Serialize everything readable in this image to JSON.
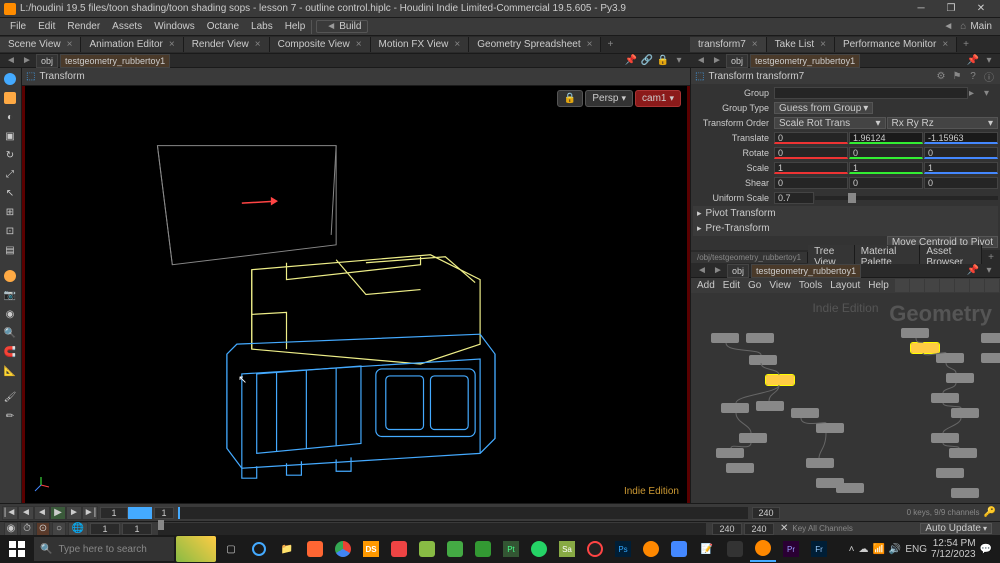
{
  "titlebar": {
    "path": "L:/houdini 19.5 files/toon shading/toon shading sops - lesson 7 - outline control.hiplc - Houdini Indie Limited-Commercial 19.5.605 - Py3.9"
  },
  "menubar": {
    "items": [
      "File",
      "Edit",
      "Render",
      "Assets",
      "Windows",
      "Octane",
      "Labs",
      "Help"
    ],
    "build": "Build",
    "main": "Main"
  },
  "left_tabs": {
    "items": [
      "Scene View",
      "Animation Editor",
      "Render View",
      "Composite View",
      "Motion FX View",
      "Geometry Spreadsheet"
    ]
  },
  "right_top_tabs": {
    "items": [
      "transform7",
      "Take List",
      "Performance Monitor"
    ]
  },
  "path_left": {
    "obj": "obj",
    "geo": "testgeometry_rubbertoy1"
  },
  "path_right": {
    "obj": "obj",
    "geo": "testgeometry_rubbertoy1"
  },
  "panel_header": {
    "title": "Transform"
  },
  "viewport": {
    "persp": "Persp",
    "cam": "cam1",
    "watermark": "Indie Edition"
  },
  "params": {
    "header": "Transform  transform7",
    "group_label": "Group",
    "group_type_label": "Group Type",
    "group_type_value": "Guess from Group",
    "transform_order_label": "Transform Order",
    "transform_order_value": "Scale Rot Trans",
    "rot_order_value": "Rx Ry Rz",
    "translate_label": "Translate",
    "translate_x": "0",
    "translate_y": "1.96124",
    "translate_z": "-1.15963",
    "rotate_label": "Rotate",
    "rotate_x": "0",
    "rotate_y": "0",
    "rotate_z": "0",
    "scale_label": "Scale",
    "scale_x": "1",
    "scale_y": "1",
    "scale_z": "1",
    "shear_label": "Shear",
    "shear_x": "0",
    "shear_y": "0",
    "shear_z": "0",
    "uniform_scale_label": "Uniform Scale",
    "uniform_scale_value": "0.7",
    "pivot_section": "Pivot Transform",
    "pre_section": "Pre-Transform",
    "move_centroid": "Move Centroid to Pivot"
  },
  "net_tabs": {
    "items": [
      "Tree View",
      "Material Palette",
      "Asset Browser"
    ],
    "path_bar": "/obj/testgeometry_rubbertoy1"
  },
  "net_path": {
    "obj": "obj",
    "geo": "testgeometry_rubbertoy1"
  },
  "net_menu": {
    "items": [
      "Add",
      "Edit",
      "Go",
      "View",
      "Tools",
      "Layout",
      "Help"
    ]
  },
  "network": {
    "watermark": "Geometry",
    "watermark2": "Indie Edition"
  },
  "timeline": {
    "start": "1",
    "end": "240",
    "current": "1",
    "range_end": "240"
  },
  "bottom": {
    "f1": "1",
    "f2": "1"
  },
  "right_status": {
    "channels": "0 keys, 9/9 channels",
    "key_all": "Key All Channels",
    "auto_update": "Auto Update"
  },
  "taskbar": {
    "search_placeholder": "Type here to search",
    "time": "12:54 PM",
    "date": "7/12/2023",
    "lang": "ENG"
  }
}
